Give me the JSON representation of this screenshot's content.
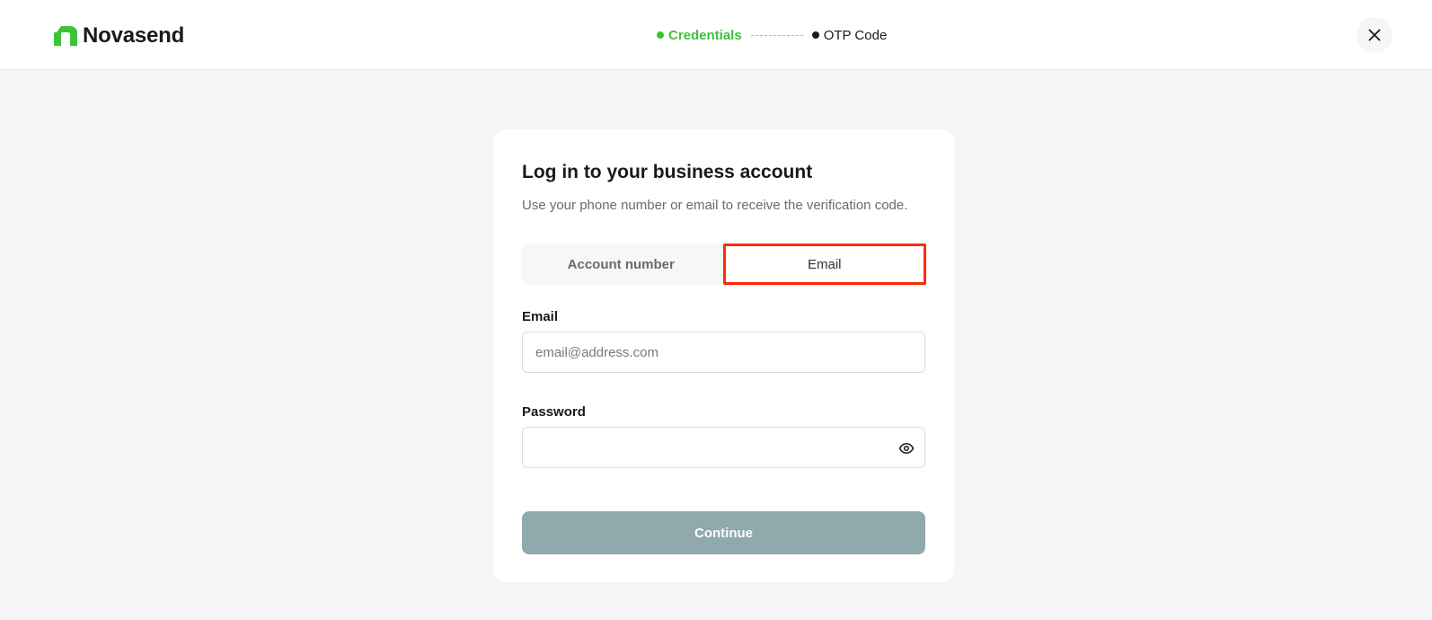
{
  "brand": {
    "name": "Novasend",
    "accent_color": "#3cc437",
    "logo_icon": "novasend-logo-icon"
  },
  "stepper": {
    "steps": [
      {
        "label": "Credentials",
        "state": "active"
      },
      {
        "label": "OTP Code",
        "state": "pending"
      }
    ]
  },
  "header": {
    "close_icon": "close-icon"
  },
  "login": {
    "title": "Log in to your business account",
    "subtitle": "Use your phone number or email to receive the verification code.",
    "tabs": [
      {
        "label": "Account number",
        "selected": false
      },
      {
        "label": "Email",
        "selected": true
      }
    ],
    "highlight_color": "#ff2a05",
    "email_label": "Email",
    "email_value": "",
    "email_placeholder": "email@address.com",
    "password_label": "Password",
    "password_value": "",
    "password_toggle_icon": "eye-icon",
    "continue_label": "Continue",
    "continue_color": "#8fa9ad"
  }
}
